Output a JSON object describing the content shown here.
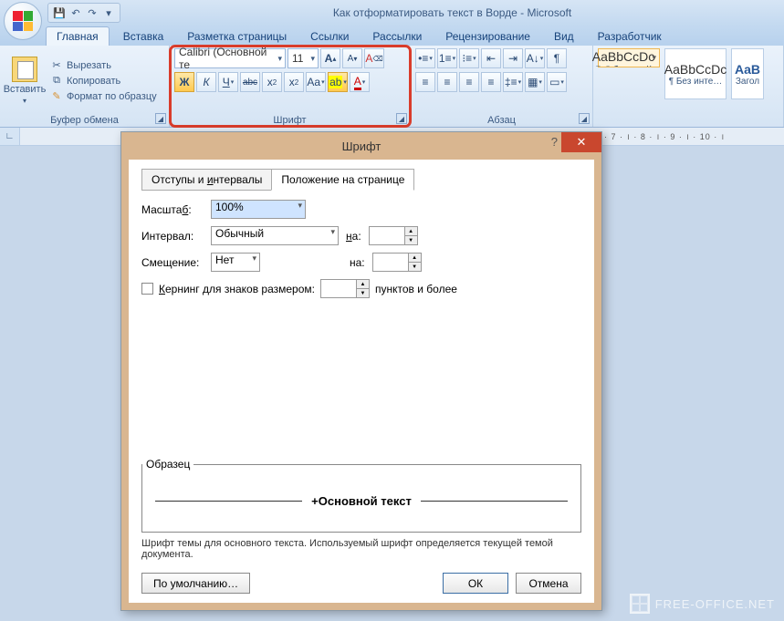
{
  "window": {
    "title": "Как отформатировать текст в Ворде - Microsoft"
  },
  "tabs": {
    "home": "Главная",
    "insert": "Вставка",
    "layout": "Разметка страницы",
    "refs": "Ссылки",
    "mail": "Рассылки",
    "review": "Рецензирование",
    "view": "Вид",
    "dev": "Разработчик"
  },
  "clipboard": {
    "paste": "Вставить",
    "cut": "Вырезать",
    "copy": "Копировать",
    "format": "Формат по образцу",
    "label": "Буфер обмена"
  },
  "font": {
    "name": "Calibri (Основной те",
    "size": "11",
    "label": "Шрифт",
    "bold": "Ж",
    "italic": "К",
    "underline": "Ч",
    "strike": "abc",
    "sub": "x",
    "sup": "x",
    "case": "Aa",
    "highlight": "ab",
    "color": "A",
    "clear": "A",
    "grow": "A",
    "shrink": "A"
  },
  "para": {
    "label": "Абзац"
  },
  "styles": {
    "preview": "AaBbCcDc",
    "normal": "¶ Обычный",
    "nospace": "¶ Без инте…",
    "heading": "Загол",
    "head_prev": "AaB"
  },
  "ruler": {
    "marks": "· 7 · । · 8 · । · 9 · । · 10 · ।"
  },
  "dialog": {
    "title": "Шрифт",
    "tab1": "Отступы и интервалы",
    "tab2": "Положение на странице",
    "scale_lbl": "Масштаб:",
    "scale_val": "100%",
    "spacing_lbl": "Интервал:",
    "spacing_val": "Обычный",
    "on_lbl": "на:",
    "pos_lbl": "Смещение:",
    "pos_val": "Нет",
    "on2_lbl": "на:",
    "kern_lbl": "Кернинг для знаков размером:",
    "kern_unit": "пунктов и более",
    "sample_lbl": "Образец",
    "sample_txt": "+Основной текст",
    "sample_desc": "Шрифт темы для основного текста. Используемый шрифт определяется текущей темой документа.",
    "defaults": "По умолчанию…",
    "ok": "ОК",
    "cancel": "Отмена"
  },
  "watermark": "FREE-OFFICE.NET"
}
